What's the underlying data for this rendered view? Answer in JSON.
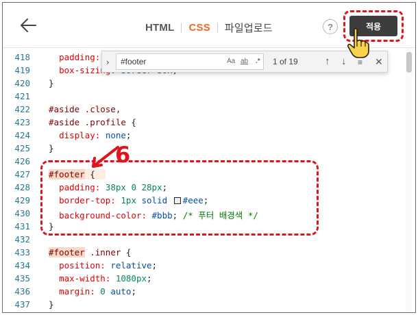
{
  "header": {
    "back_label": "back",
    "tabs": [
      {
        "label": "HTML",
        "active": false
      },
      {
        "label": "CSS",
        "active": true
      },
      {
        "label": "파일업로드",
        "active": false
      }
    ],
    "help_label": "?",
    "apply_label": "적용"
  },
  "find": {
    "query": "#footer",
    "match_case": "Aa",
    "whole_word": "ab",
    "regex": ".*",
    "count": "1 of 19"
  },
  "editor": {
    "lines": [
      {
        "num": "418"
      },
      {
        "num": "419"
      },
      {
        "num": "420"
      },
      {
        "num": "421"
      },
      {
        "num": "422"
      },
      {
        "num": "423"
      },
      {
        "num": "424"
      },
      {
        "num": "425"
      },
      {
        "num": "426"
      },
      {
        "num": "427"
      },
      {
        "num": "428"
      },
      {
        "num": "429"
      },
      {
        "num": "430"
      },
      {
        "num": "431"
      },
      {
        "num": "432"
      },
      {
        "num": "433"
      },
      {
        "num": "434"
      },
      {
        "num": "435"
      },
      {
        "num": "436"
      },
      {
        "num": "437"
      }
    ]
  },
  "annotation": {
    "step_label": "6"
  },
  "colors": {
    "accent": "#f06a22",
    "annotation_red": "#e0141c",
    "apply_bg": "#3c3c3c",
    "line_number": "#237893",
    "selector": "#800000",
    "property": "#e50000",
    "number": "#098658",
    "keyword": "#0451a5",
    "comment": "#008000"
  }
}
